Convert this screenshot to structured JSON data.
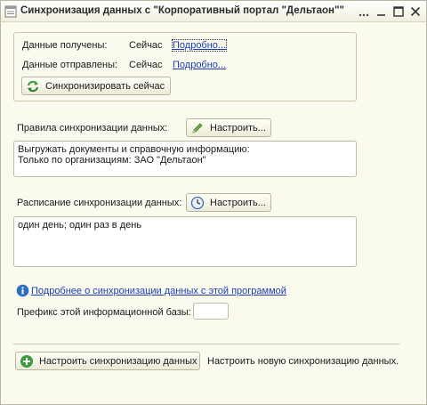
{
  "window": {
    "title": "Синхронизация данных с \"Корпоративный портал \"Дельтаон\"\""
  },
  "status_panel": {
    "received_label": "Данные получены:",
    "received_value": "Сейчас",
    "received_link": "Подробно...",
    "sent_label": "Данные отправлены:",
    "sent_value": "Сейчас",
    "sent_link": "Подробно...",
    "sync_now_button": "Синхронизировать сейчас"
  },
  "rules": {
    "label": "Правила синхронизации данных:",
    "configure_button": "Настроить...",
    "text": "Выгружать документы и справочную информацию:\nТолько по организациям: ЗАО \"Дельтаон\""
  },
  "schedule": {
    "label": "Расписание синхронизации данных:",
    "configure_button": "Настроить...",
    "text": "один день; один раз в день"
  },
  "info": {
    "link": "Подробнее о синхронизации данных с этой программой"
  },
  "prefix": {
    "label": "Префикс этой информационной базы:",
    "value": ""
  },
  "footer": {
    "setup_button": "Настроить синхронизацию данных",
    "description": "Настроить новую синхронизацию данных."
  },
  "colors": {
    "link": "#1b3fb0",
    "window_bg": "#fbfaef"
  }
}
